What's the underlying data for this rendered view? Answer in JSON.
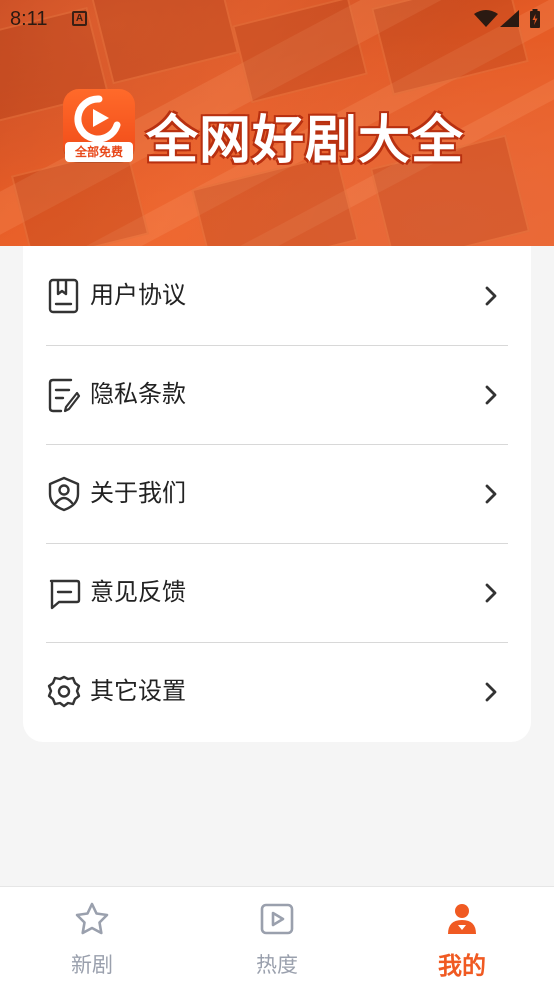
{
  "status_bar": {
    "time": "8:11",
    "notification_icon": "a-icon",
    "icons": [
      "wifi-icon",
      "signal-icon",
      "battery-icon"
    ]
  },
  "header": {
    "logo_badge": "全部免费",
    "title": "全网好剧大全",
    "accent_color": "#f05a22"
  },
  "menu": {
    "items": [
      {
        "label": "用户协议",
        "icon": "document-icon"
      },
      {
        "label": "隐私条款",
        "icon": "edit-document-icon"
      },
      {
        "label": "关于我们",
        "icon": "shield-user-icon"
      },
      {
        "label": "意见反馈",
        "icon": "message-icon"
      },
      {
        "label": "其它设置",
        "icon": "gear-icon"
      }
    ]
  },
  "bottom_nav": {
    "items": [
      {
        "label": "新剧",
        "icon": "star-icon",
        "active": false
      },
      {
        "label": "热度",
        "icon": "play-icon",
        "active": false
      },
      {
        "label": "我的",
        "icon": "user-icon",
        "active": true
      }
    ],
    "active_color": "#f05a22",
    "inactive_color": "#9aa0ad"
  }
}
